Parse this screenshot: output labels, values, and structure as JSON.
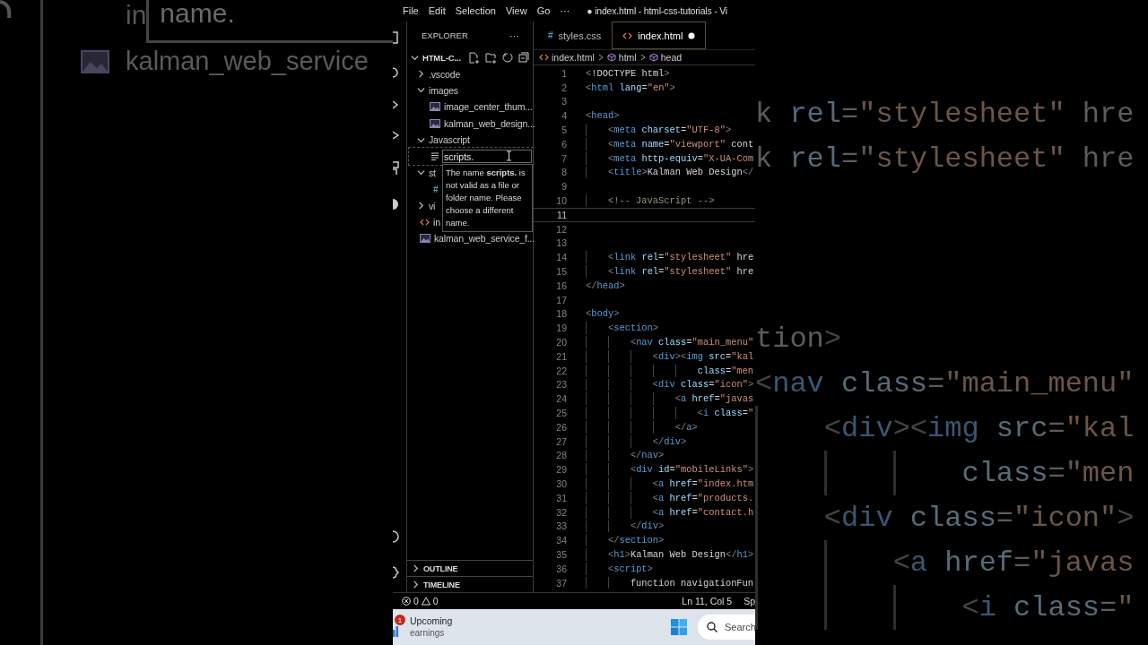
{
  "backdrop_left": {
    "cut_label": "in",
    "tooltip_fragment": "name.",
    "file_label": "kalman_web_service"
  },
  "backdrop_right": {
    "lines_top": [
      "k rel=\"stylesheet\" hre",
      "k rel=\"stylesheet\" hre"
    ],
    "lines_bottom": [
      "tion>",
      "<nav class=\"main_menu\"",
      "    <div><img src=\"kal",
      "            class=\"men",
      "    <div class=\"icon\">",
      "        <a href=\"javas",
      "            <i class=\""
    ]
  },
  "menu": [
    "File",
    "Edit",
    "Selection",
    "View",
    "Go",
    "···"
  ],
  "window": {
    "title": "● index.html - html-css-tutorials - Vi"
  },
  "explorer": {
    "title": "EXPLORER",
    "more": "···",
    "root": {
      "label": "HTML-C...",
      "expanded": true,
      "children": [
        {
          "kind": "folder",
          "label": ".vscode",
          "expanded": false
        },
        {
          "kind": "folder",
          "label": "images",
          "expanded": true,
          "children": [
            {
              "kind": "image",
              "label": "image_center_thum..."
            },
            {
              "kind": "image",
              "label": "kalman_web_design..."
            }
          ]
        },
        {
          "kind": "folder",
          "label": "Javascript",
          "expanded": true,
          "children": [
            {
              "kind": "rename",
              "value": "scripts.",
              "error": "The name **scripts.** is not valid as a file or folder name. Please choose a different name."
            }
          ]
        },
        {
          "kind": "folder",
          "label": "st",
          "expanded": true,
          "children": [
            {
              "kind": "css",
              "icon": "#"
            }
          ]
        },
        {
          "kind": "folder",
          "label": "vi",
          "expanded": false
        },
        {
          "kind": "html",
          "label": "in"
        },
        {
          "kind": "image",
          "label": "kalman_web_service_f..."
        }
      ]
    }
  },
  "panels": [
    {
      "label": "OUTLINE",
      "expanded": false
    },
    {
      "label": "TIMELINE",
      "expanded": false
    }
  ],
  "tabs": [
    {
      "label": "styles.css",
      "kind": "css",
      "icon": "#",
      "selected": false,
      "modified": false
    },
    {
      "label": "index.html",
      "kind": "html",
      "selected": true,
      "modified": true
    }
  ],
  "breadcrumb": [
    "index.html",
    "html",
    "head"
  ],
  "code": [
    {
      "n": "1",
      "text": "<!DOCTYPE html>"
    },
    {
      "n": "2",
      "text": "<html lang=\"en\">"
    },
    {
      "n": "3"
    },
    {
      "n": "4",
      "text": "<head>"
    },
    {
      "n": "5",
      "text": "    <meta charset=\"UTF-8\">"
    },
    {
      "n": "6",
      "text": "    <meta name=\"viewport\" cont"
    },
    {
      "n": "7",
      "text": "    <meta http-equiv=\"X-UA-Com"
    },
    {
      "n": "8",
      "text": "    <title>Kalman Web Design</"
    },
    {
      "n": "9"
    },
    {
      "n": "10",
      "text": "    <!-- JavaScript -->"
    },
    {
      "n": "11",
      "current": true
    },
    {
      "n": "12"
    },
    {
      "n": "13"
    },
    {
      "n": "14",
      "text": "    <link rel=\"stylesheet\" hre"
    },
    {
      "n": "15",
      "text": "    <link rel=\"stylesheet\" hre"
    },
    {
      "n": "16",
      "text": "</head>"
    },
    {
      "n": "17"
    },
    {
      "n": "18",
      "text": "<body>"
    },
    {
      "n": "19",
      "text": "    <section>"
    },
    {
      "n": "20",
      "text": "        <nav class=\"main_menu\""
    },
    {
      "n": "21",
      "text": "            <div><img src=\"kal"
    },
    {
      "n": "22",
      "text": "                    class=\"men"
    },
    {
      "n": "23",
      "text": "            <div class=\"icon\">"
    },
    {
      "n": "24",
      "text": "                <a href=\"javas"
    },
    {
      "n": "25",
      "text": "                    <i class=\""
    },
    {
      "n": "26",
      "text": "                </a>"
    },
    {
      "n": "27",
      "text": "            </div>"
    },
    {
      "n": "28",
      "text": "        </nav>"
    },
    {
      "n": "29",
      "text": "        <div id=\"mobileLinks\">"
    },
    {
      "n": "30",
      "text": "            <a href=\"index.htm"
    },
    {
      "n": "31",
      "text": "            <a href=\"products."
    },
    {
      "n": "32",
      "text": "            <a href=\"contact.h"
    },
    {
      "n": "33",
      "text": "        </div>"
    },
    {
      "n": "34",
      "text": "    </section>"
    },
    {
      "n": "35",
      "text": "    <h1>Kalman Web Design</h1>"
    },
    {
      "n": "36",
      "text": "    <script>"
    },
    {
      "n": "37",
      "text": "        function navigationFun"
    }
  ],
  "status_bar": {
    "errors": "0",
    "warnings": "0",
    "position": "Ln 11, Col 5",
    "spaces": "Sp"
  },
  "taskbar": {
    "badge": "1",
    "widget_title": "Upcoming",
    "widget_subtitle": "earnings",
    "search": "Search"
  }
}
